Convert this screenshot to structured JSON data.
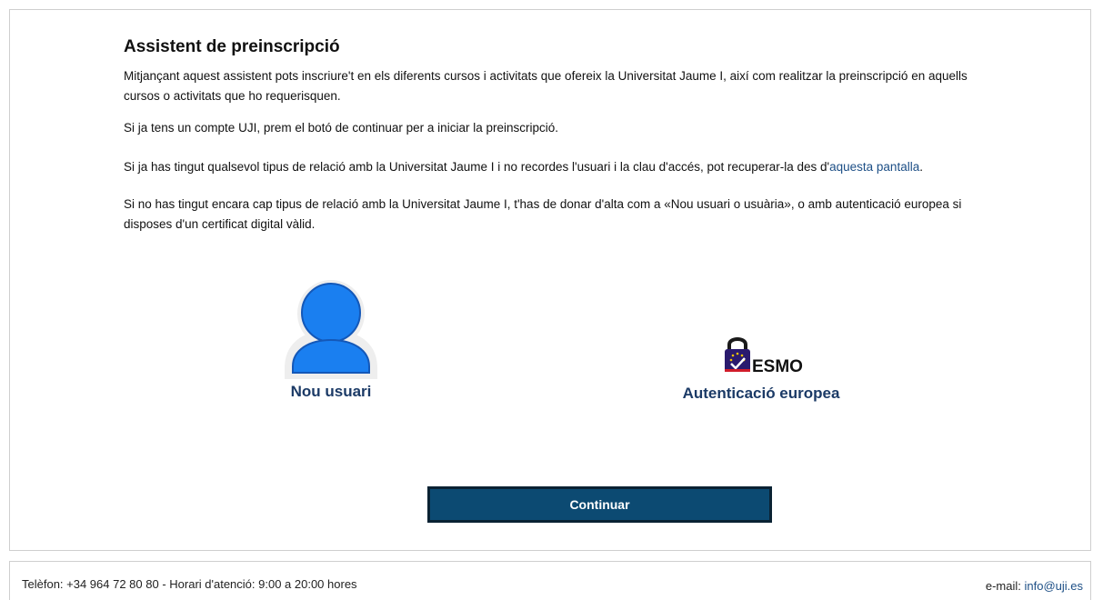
{
  "page": {
    "title": "Assistent de preinscripció"
  },
  "intro": {
    "p1": "Mitjançant aquest assistent pots inscriure't en els diferents cursos i activitats que ofereix la Universitat Jaume I, així com realitzar la preinscripció en aquells cursos o activitats que ho requerisquen.",
    "p2": "Si ja tens un compte UJI, prem el botó de continuar per a iniciar la preinscripció.",
    "p3_before": "Si ja has tingut qualsevol tipus de relació amb la Universitat Jaume I i no recordes l'usuari i la clau d'accés, pot recuperar-la des d'",
    "p3_link": "aquesta pantalla",
    "p3_after": ".",
    "p4": "Si no has tingut encara cap tipus de relació amb la Universitat Jaume I, t'has de donar d'alta com a «Nou usuari o usuària», o amb autenticació europea si disposes d'un certificat digital vàlid."
  },
  "options": {
    "new_user": {
      "label": "Nou usuari",
      "icon": "user-avatar-icon"
    },
    "european_auth": {
      "label": "Autenticació europea",
      "logo_text": "ESMO",
      "icon": "padlock-eu-icon"
    }
  },
  "actions": {
    "continue_label": "Continuar"
  },
  "footer": {
    "phone_text": "Telèfon: +34 964 72 80 80 - Horari d'atenció: 9:00 a 20:00 hores",
    "email_label": "e-mail: ",
    "email_link": "info@uji.es"
  },
  "colors": {
    "accent_blue": "#0c4a72",
    "link_blue": "#1d4f86",
    "label_navy": "#1b3a66",
    "avatar_blue": "#1a7ff0"
  }
}
